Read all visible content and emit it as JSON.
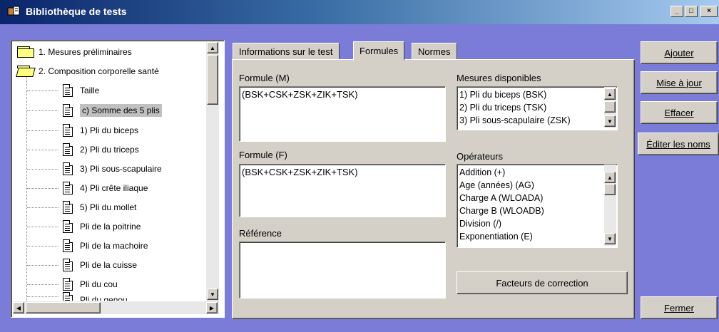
{
  "window": {
    "title": "Bibliothèque de tests"
  },
  "tree": {
    "items": [
      {
        "label": "1. Mesures préliminaires",
        "type": "folder"
      },
      {
        "label": "2. Composition corporelle santé",
        "type": "folder-open"
      },
      {
        "label": "Taille",
        "type": "doc"
      },
      {
        "label": "c) Somme des 5 plis",
        "type": "doc",
        "selected": true
      },
      {
        "label": "1) Pli du biceps",
        "type": "doc"
      },
      {
        "label": "2) Pli du triceps",
        "type": "doc"
      },
      {
        "label": "3) Pli sous-scapulaire",
        "type": "doc"
      },
      {
        "label": "4) Pli crête iliaque",
        "type": "doc"
      },
      {
        "label": "5) Pli du mollet",
        "type": "doc"
      },
      {
        "label": "Pli de la poitrine",
        "type": "doc"
      },
      {
        "label": "Pli de la machoire",
        "type": "doc"
      },
      {
        "label": "Pli de la cuisse",
        "type": "doc"
      },
      {
        "label": "Pli du cou",
        "type": "doc"
      },
      {
        "label": "Pli du genou",
        "type": "doc"
      }
    ]
  },
  "tabs": [
    {
      "label": "Informations sur le test",
      "active": false
    },
    {
      "label": "Formules",
      "active": true
    },
    {
      "label": "Normes",
      "active": false
    }
  ],
  "formules": {
    "formule_m_label": "Formule (M)",
    "formule_m_value": "(BSK+CSK+ZSK+ZIK+TSK)",
    "formule_f_label": "Formule (F)",
    "formule_f_value": "(BSK+CSK+ZSK+ZIK+TSK)",
    "reference_label": "Référence",
    "reference_value": "",
    "mesures_label": "Mesures disponibles",
    "mesures": [
      "1) Pli du biceps (BSK)",
      "2) Pli du triceps (TSK)",
      "3) Pli sous-scapulaire (ZSK)"
    ],
    "operateurs_label": "Opérateurs",
    "operateurs": [
      "Addition (+)",
      "Age (années) (AG)",
      "Charge A (WLOADA)",
      "Charge B (WLOADB)",
      "Division (/)",
      "Exponentiation (E)"
    ],
    "facteurs_button": "Facteurs de correction"
  },
  "buttons": {
    "ajouter": "Ajouter",
    "mise_a_jour": "Mise à jour",
    "effacer": "Effacer",
    "editer_noms": "Éditer les noms",
    "fermer": "Fermer"
  }
}
